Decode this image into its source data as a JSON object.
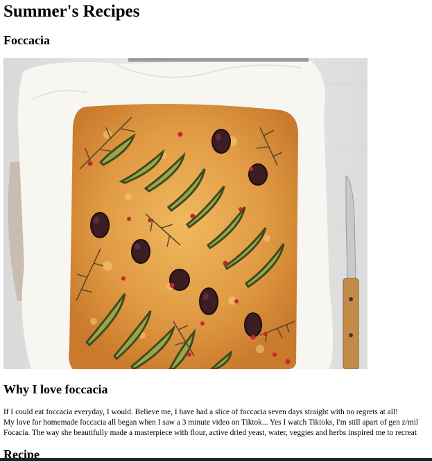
{
  "page": {
    "title": "Summer's Recipes",
    "subtitle": "Foccacia"
  },
  "photo": {
    "alt": "Foccacia"
  },
  "section_love": {
    "heading": "Why I love foccacia",
    "lines": [
      "If I could eat foccacia everyday, I would. Believe me, I have had a slice of foccacia seven days straight with no regrets at all!",
      "My love for homemade foccacia all began when I saw a 3 minute video on Tiktok... Yes I watch Tiktoks, I'm still apart of gen z/mil",
      "Focacia. The way she beautifully made a masterpiece with flour, active dried yeast, water, veggies and herbs inspired me to recreat"
    ]
  },
  "section_recipe": {
    "heading": "Recipe"
  },
  "colors": {
    "crust": "#e2a04a",
    "paper": "#f6f4ef",
    "background_wall": "#e8e8e8"
  }
}
